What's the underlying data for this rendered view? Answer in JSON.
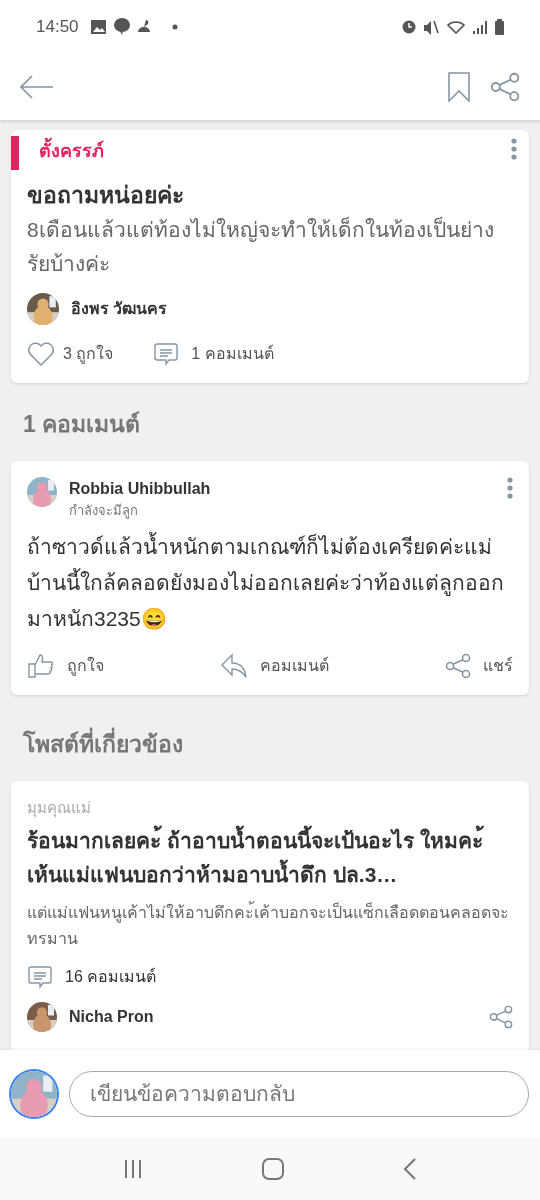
{
  "status_bar": {
    "time": "14:50"
  },
  "post": {
    "category": "ตั้งครรภ์",
    "title": "ขอถามหน่อยค่ะ",
    "body": "8เดือนแล้วแต่ท้องไม่ใหญ่จะทำให้เด็กในท้องเป็นย่างรัยบ้างค่ะ",
    "author": "อิงพร วัฒนคร",
    "likes": "3 ถูกใจ",
    "comments": "1 คอมเมนต์",
    "liked": false
  },
  "comments_heading": "1 คอมเมนต์",
  "comments": [
    {
      "author": "Robbia Uhibbullah",
      "status": "กำลังจะมีลูก",
      "text": "ถ้าซาวด์แล้วน้ำหนักตามเกณฑ์ก็ไม่ต้องเครียดค่ะแม่ บ้านนี้ใกล้คลอดยังมองไม่ออกเลยค่ะว่าท้องแต่ลูกออกมาหนัก3235😄",
      "actions": [
        "ถูกใจ",
        "คอมเมนต์",
        "แชร์"
      ]
    }
  ],
  "related_heading": "โพสต์ที่เกี่ยวข้อง",
  "related": [
    {
      "category": "มุมคุณแม่",
      "title": "ร้อนมากเลยคะ้ ถ้าอาบน้ำตอนนี้จะเป้นอะไร ใหมคะ้เห้นแม่แฟนบอกว่าห้ามอาบน้ำดึก ปล.3…",
      "excerpt": "แต่แม่แฟนหนูเค้าไม่ให้อาบดึกคะ้เค้าบอกจะเป็นแซ็กเลือดตอนคลอดจะทรมาน",
      "comments": "16 คอมเมนต์",
      "author": "Nicha Pron"
    }
  ],
  "reply": {
    "placeholder": "เขียนข้อความตอบกลับ"
  }
}
